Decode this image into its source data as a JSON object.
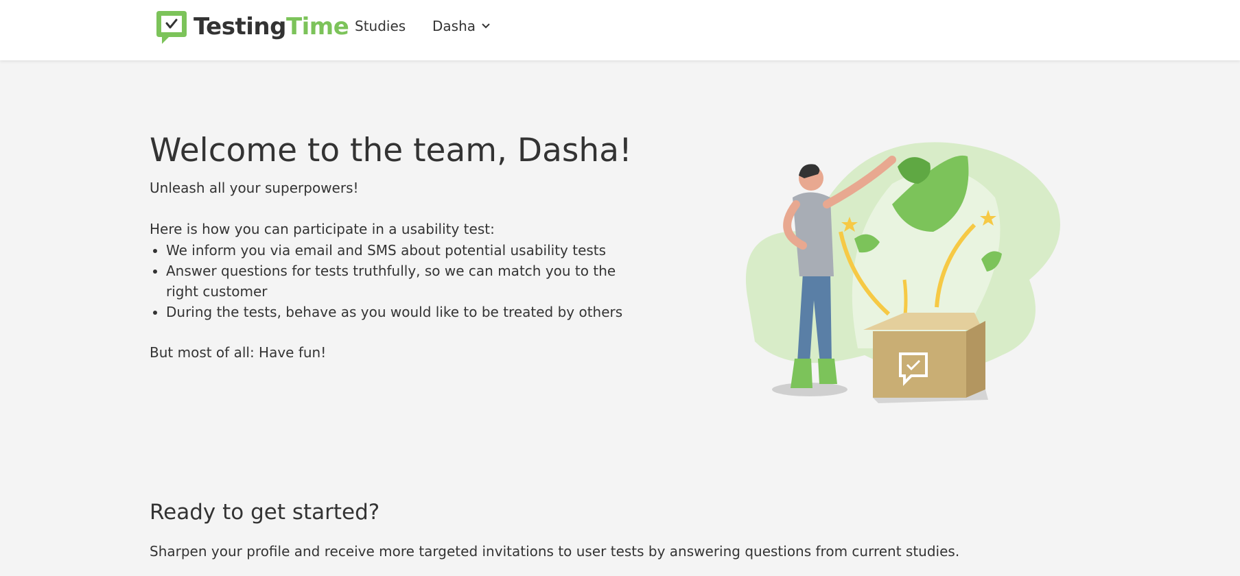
{
  "header": {
    "logo": {
      "brand_part1": "Testing",
      "brand_part2": "Time",
      "icon": "speech-bubble-check-icon"
    },
    "nav": {
      "studies_label": "Studies",
      "user_label": "Dasha",
      "user_menu_icon": "chevron-down-icon"
    }
  },
  "welcome": {
    "title": "Welcome to the team, Dasha!",
    "subtitle": "Unleash all your superpowers!",
    "intro": "Here is how you can participate in a usability test:",
    "steps": [
      "We inform you via email and SMS about potential usability tests",
      "Answer questions for tests truthfully, so we can match you to the right customer",
      "During the tests, behave as you would like to be treated by others"
    ],
    "closing": "But most of all: Have fun!"
  },
  "get_started": {
    "title": "Ready to get started?",
    "text": "Sharpen your profile and receive more targeted invitations to user tests by answering questions from current studies."
  },
  "colors": {
    "brand_green": "#7cc35a",
    "text": "#333333",
    "background": "#f4f4f4",
    "header_bg": "#ffffff"
  }
}
